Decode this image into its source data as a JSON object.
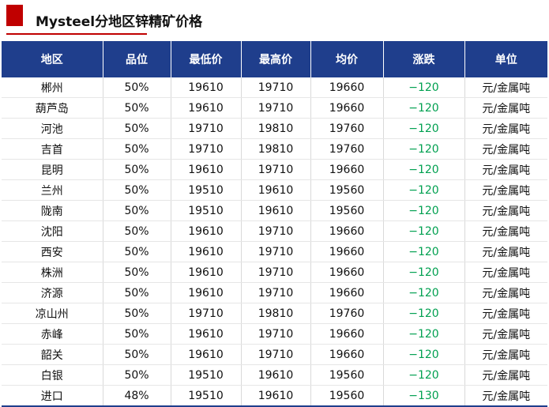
{
  "header": {
    "title": "Mysteel分地区锌精矿价格"
  },
  "colors": {
    "accent": "#c00000",
    "header_bg": "#1f3e8c",
    "change": "#00a050"
  },
  "table": {
    "columns": [
      "地区",
      "品位",
      "最低价",
      "最高价",
      "均价",
      "涨跌",
      "单位"
    ],
    "rows": [
      [
        "郴州",
        "50%",
        "19610",
        "19710",
        "19660",
        "−120",
        "元/金属吨"
      ],
      [
        "葫芦岛",
        "50%",
        "19610",
        "19710",
        "19660",
        "−120",
        "元/金属吨"
      ],
      [
        "河池",
        "50%",
        "19710",
        "19810",
        "19760",
        "−120",
        "元/金属吨"
      ],
      [
        "吉首",
        "50%",
        "19710",
        "19810",
        "19760",
        "−120",
        "元/金属吨"
      ],
      [
        "昆明",
        "50%",
        "19610",
        "19710",
        "19660",
        "−120",
        "元/金属吨"
      ],
      [
        "兰州",
        "50%",
        "19510",
        "19610",
        "19560",
        "−120",
        "元/金属吨"
      ],
      [
        "陇南",
        "50%",
        "19510",
        "19610",
        "19560",
        "−120",
        "元/金属吨"
      ],
      [
        "沈阳",
        "50%",
        "19610",
        "19710",
        "19660",
        "−120",
        "元/金属吨"
      ],
      [
        "西安",
        "50%",
        "19610",
        "19710",
        "19660",
        "−120",
        "元/金属吨"
      ],
      [
        "株洲",
        "50%",
        "19610",
        "19710",
        "19660",
        "−120",
        "元/金属吨"
      ],
      [
        "济源",
        "50%",
        "19610",
        "19710",
        "19660",
        "−120",
        "元/金属吨"
      ],
      [
        "凉山州",
        "50%",
        "19710",
        "19810",
        "19760",
        "−120",
        "元/金属吨"
      ],
      [
        "赤峰",
        "50%",
        "19610",
        "19710",
        "19660",
        "−120",
        "元/金属吨"
      ],
      [
        "韶关",
        "50%",
        "19610",
        "19710",
        "19660",
        "−120",
        "元/金属吨"
      ],
      [
        "白银",
        "50%",
        "19510",
        "19610",
        "19560",
        "−120",
        "元/金属吨"
      ],
      [
        "进口",
        "48%",
        "19510",
        "19610",
        "19560",
        "−130",
        "元/金属吨"
      ]
    ]
  }
}
